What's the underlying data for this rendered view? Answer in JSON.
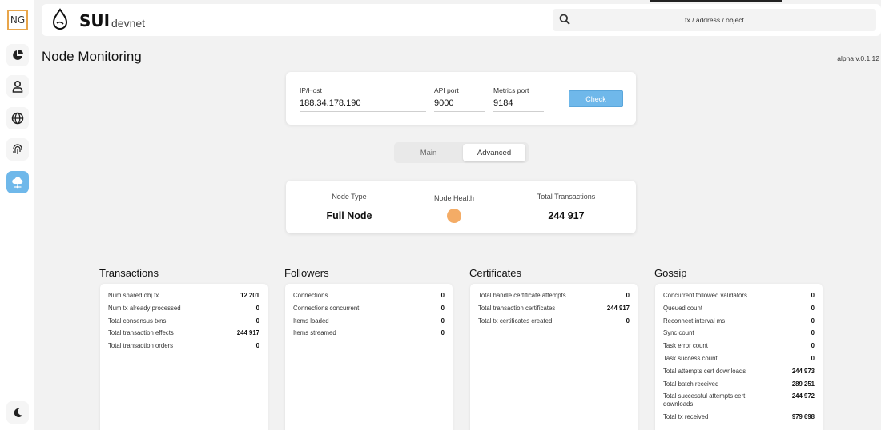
{
  "sidebar": {
    "logo_text": "NG",
    "items": [
      {
        "icon": "pie-chart-icon"
      },
      {
        "icon": "user-icon"
      },
      {
        "icon": "globe-icon"
      },
      {
        "icon": "fingerprint-icon"
      },
      {
        "icon": "cloud-network-icon",
        "active": true
      }
    ],
    "bottom_icon": "moon-icon"
  },
  "header": {
    "brand": "SUI",
    "network": "devnet",
    "search_placeholder": "tx / address / object"
  },
  "page": {
    "title": "Node Monitoring",
    "version": "alpha v.0.1.12"
  },
  "form": {
    "host_label": "IP/Host",
    "host_value": "188.34.178.190",
    "api_label": "API port",
    "api_value": "9000",
    "metrics_label": "Metrics port",
    "metrics_value": "9184",
    "check_label": "Check"
  },
  "tabs": [
    {
      "label": "Main",
      "active": false
    },
    {
      "label": "Advanced",
      "active": true
    }
  ],
  "summary": {
    "node_type_label": "Node Type",
    "node_type_value": "Full Node",
    "health_label": "Node Health",
    "health_color": "#f4ac66",
    "total_tx_label": "Total Transactions",
    "total_tx_value": "244 917"
  },
  "sections": [
    {
      "title": "Transactions",
      "rows": [
        {
          "label": "Num shared obj tx",
          "value": "12 201"
        },
        {
          "label": "Num tx already processed",
          "value": "0"
        },
        {
          "label": "Total consensus txns",
          "value": "0"
        },
        {
          "label": "Total transaction effects",
          "value": "244 917"
        },
        {
          "label": "Total transaction orders",
          "value": "0"
        }
      ]
    },
    {
      "title": "Followers",
      "rows": [
        {
          "label": "Connections",
          "value": "0"
        },
        {
          "label": "Connections concurrent",
          "value": "0"
        },
        {
          "label": "Items loaded",
          "value": "0"
        },
        {
          "label": "Items streamed",
          "value": "0"
        }
      ]
    },
    {
      "title": "Certificates",
      "rows": [
        {
          "label": "Total handle certificate attempts",
          "value": "0"
        },
        {
          "label": "Total transaction certificates",
          "value": "244 917"
        },
        {
          "label": "Total tx certificates created",
          "value": "0"
        }
      ]
    },
    {
      "title": "Gossip",
      "rows": [
        {
          "label": "Concurrent followed validators",
          "value": "0"
        },
        {
          "label": "Queued count",
          "value": "0"
        },
        {
          "label": "Reconnect interval ms",
          "value": "0"
        },
        {
          "label": "Sync count",
          "value": "0"
        },
        {
          "label": "Task error count",
          "value": "0"
        },
        {
          "label": "Task success count",
          "value": "0"
        },
        {
          "label": "Total attempts cert downloads",
          "value": "244 973"
        },
        {
          "label": "Total batch received",
          "value": "289 251"
        },
        {
          "label": "Total successful attempts cert downloads",
          "value": "244 972"
        },
        {
          "label": "Total tx received",
          "value": "979 698"
        }
      ]
    }
  ]
}
